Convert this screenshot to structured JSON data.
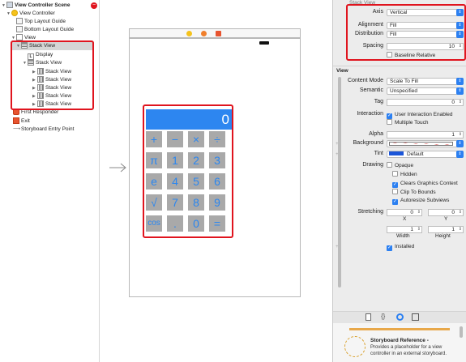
{
  "outline": {
    "scene_title": "View Controller Scene",
    "view_controller": "View Controller",
    "top_layout_guide": "Top Layout Guide",
    "bottom_layout_guide": "Bottom Layout Guide",
    "view": "View",
    "stack_view": "Stack View",
    "display_label_glyph": "L",
    "display": "Display",
    "inner_stack_view": "Stack View",
    "row_stack_views": [
      "Stack View",
      "Stack View",
      "Stack View",
      "Stack View",
      "Stack View"
    ],
    "first_responder": "First Responder",
    "exit": "Exit",
    "entry_point": "Storyboard Entry Point"
  },
  "calculator": {
    "display_value": "0",
    "keys": [
      [
        "+",
        "−",
        "×",
        "÷"
      ],
      [
        "π",
        "1",
        "2",
        "3"
      ],
      [
        "e",
        "4",
        "5",
        "6"
      ],
      [
        "√",
        "7",
        "8",
        "9"
      ],
      [
        "cos",
        ".",
        "0",
        "="
      ]
    ]
  },
  "inspector": {
    "stack_header": "Stack View",
    "axis_label": "Axis",
    "axis_value": "Vertical",
    "alignment_label": "Alignment",
    "alignment_value": "Fill",
    "distribution_label": "Distribution",
    "distribution_value": "Fill",
    "spacing_label": "Spacing",
    "spacing_value": "10",
    "baseline_relative": "Baseline Relative",
    "view_section": "View",
    "content_mode_label": "Content Mode",
    "content_mode_value": "Scale To Fill",
    "semantic_label": "Semantic",
    "semantic_value": "Unspecified",
    "tag_label": "Tag",
    "tag_value": "0",
    "interaction_label": "Interaction",
    "user_interaction": "User Interaction Enabled",
    "multiple_touch": "Multiple Touch",
    "alpha_label": "Alpha",
    "alpha_value": "1",
    "background_label": "Background",
    "tint_label": "Tint",
    "tint_value": "Default",
    "drawing_label": "Drawing",
    "opaque": "Opaque",
    "hidden": "Hidden",
    "clears_graphics": "Clears Graphics Context",
    "clip_to_bounds": "Clip To Bounds",
    "autoresize": "Autoresize Subviews",
    "stretching_label": "Stretching",
    "stretch_x": "0",
    "stretch_y": "0",
    "x_label": "X",
    "y_label": "Y",
    "stretch_w": "1",
    "stretch_h": "1",
    "width_label": "Width",
    "height_label": "Height",
    "installed": "Installed",
    "library_title": "Storyboard Reference",
    "library_dash": "-",
    "library_desc_1": "Provides a placeholder for a view",
    "library_desc_2": "controller in an external storyboard.",
    "library_icons": [
      "file-icon",
      "braces-icon",
      "circle-target-icon",
      "object-icon"
    ]
  },
  "colors": {
    "highlight_red": "#e0141e",
    "accent_blue": "#2c80f1",
    "display_blue": "#2d86f0",
    "key_gray": "#a9a9a9"
  }
}
